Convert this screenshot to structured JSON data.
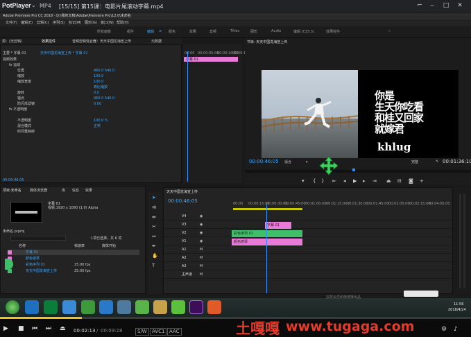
{
  "player": {
    "logo": "PotPlayer",
    "format": "MP4",
    "title": "[15/15] 第15课：电影片尾滚动字幕.mp4",
    "current_time": "00:02:13",
    "total_time": "00:09:28",
    "badges": [
      "S/W",
      "AVC1",
      "AAC"
    ],
    "progress": 0.17
  },
  "premiere": {
    "title": "Adobe Premiere Pro CC 2018 - D:\\我的文档\\Adobe\\Premiere Pro\\12.0\\未命名",
    "menu": [
      "文件(F)",
      "编辑(E)",
      "剪辑(C)",
      "序列(S)",
      "标记(M)",
      "图形(G)",
      "窗口(W)",
      "帮助(H)"
    ],
    "workspaces": [
      "所有面板",
      "组件",
      "编辑",
      "颜色",
      "效果",
      "音频",
      "Titles",
      "图形",
      "Audio",
      "编辑 (CS5.5)",
      "效果控件"
    ],
    "active_workspace": "编辑"
  },
  "effect_controls": {
    "tabs": [
      "源：(无剪辑)",
      "效果控件",
      "音频剪辑混合器：天天中国龙海宣上传",
      "元数据"
    ],
    "clip_label": "主要 * 字幕 01",
    "seq_label": "天天中国龙海宣上传 * 字幕 01",
    "section_video": "视频效果",
    "rows": [
      {
        "label": "fx 运动",
        "value": ""
      },
      {
        "label": "位置",
        "value": "960.0  540.0"
      },
      {
        "label": "缩放",
        "value": "100.0"
      },
      {
        "label": "缩放宽度",
        "value": "100.0"
      },
      {
        "label": "",
        "value": "等比缩放"
      },
      {
        "label": "旋转",
        "value": "0.0"
      },
      {
        "label": "锚点",
        "value": "960.0  540.0"
      },
      {
        "label": "防闪烁滤镜",
        "value": "0.00"
      },
      {
        "label": "fx 不透明度",
        "value": ""
      },
      {
        "label": "",
        "value": ""
      },
      {
        "label": "不透明度",
        "value": "100.0 %"
      },
      {
        "label": "混合模式",
        "value": "正常"
      },
      {
        "label": "时间重映射",
        "value": ""
      }
    ],
    "timecode": "00:00:46:05",
    "mini_timecodes": [
      "00:00",
      "00:00:05:00",
      "00:00:10:00",
      "00:00:15"
    ],
    "clip_name": "字幕 01"
  },
  "program": {
    "title": "节目: 天天中国龙海宣上传",
    "timecode": "00:00:46:05",
    "fit": "适合",
    "quality": "完整",
    "duration": "00:01:36:10",
    "overlay_text_lines": [
      "你是",
      "生天你吃看",
      "和桂又回家",
      "就嫁君"
    ],
    "watermark": "khlug"
  },
  "project": {
    "tabs": [
      "项目:未命名",
      "媒体浏览器",
      "库",
      "信息",
      "效果"
    ],
    "item_name": "字幕 01",
    "item_info": "视频,1920 x 1080 (1.0) Alpha",
    "project_file": "未命名.prproj",
    "search_label": "1项已选择，共 6 项",
    "columns": [
      "名称",
      "帧速率",
      "媒体开始"
    ],
    "items": [
      {
        "name": "字幕 01",
        "fps": "",
        "start": "",
        "color": "#e87ad8"
      },
      {
        "name": "颜色遮罩",
        "fps": "",
        "start": "",
        "color": "#e87ad8"
      },
      {
        "name": "彩色序列 01",
        "fps": "25.00 fps",
        "start": "",
        "color": "#3fbf6a"
      },
      {
        "name": "天天中国龙海宣上传",
        "fps": "25.00 fps",
        "start": "",
        "color": "#3fbf6a"
      }
    ]
  },
  "timeline": {
    "tab": "天天中国龙海宣上传",
    "timecode": "00:00:46:05",
    "ruler": [
      "00:00",
      "00:00:15:00",
      "00:00:30:00",
      "00:00:45:00",
      "00:01:00:00",
      "00:01:15:00",
      "00:01:30:00",
      "00:01:45:00",
      "00:02:00:00",
      "00:02:15:00",
      "00:02:30:00",
      "00:02:45:00",
      "00:03:00:00",
      "00:04:00:00"
    ],
    "tracks": [
      "V4",
      "V3",
      "V2",
      "V1",
      "A1",
      "A2",
      "A3",
      "主声道"
    ],
    "master_value": "0.0",
    "clips": [
      {
        "name": "字幕 01",
        "track": 1,
        "color": "#e87ad8"
      },
      {
        "name": "彩色序列 01",
        "track": 2,
        "color": "#3fbf6a"
      },
      {
        "name": "颜色遮罩",
        "track": 3,
        "color": "#e87ad8"
      }
    ]
  },
  "taskbar": {
    "time": "11:56",
    "date": "2018/4/24",
    "watermark": "授权会员和微博推出品"
  },
  "site_watermark": {
    "cn": "土嘎嘎",
    "url": "www.tugaga.com"
  }
}
